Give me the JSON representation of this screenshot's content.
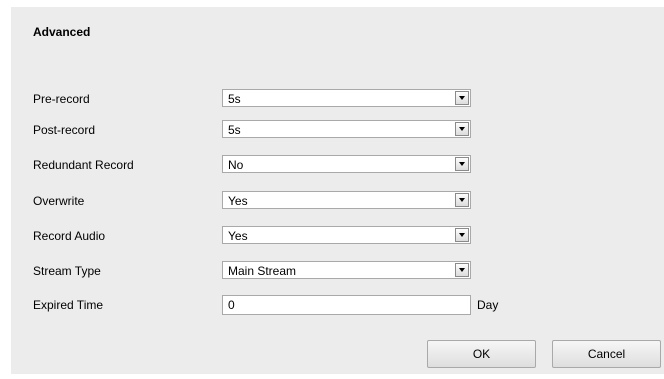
{
  "section": {
    "title": "Advanced"
  },
  "fields": {
    "pre_record": {
      "label": "Pre-record",
      "value": "5s"
    },
    "post_record": {
      "label": "Post-record",
      "value": "5s"
    },
    "redundant_record": {
      "label": "Redundant Record",
      "value": "No"
    },
    "overwrite": {
      "label": "Overwrite",
      "value": "Yes"
    },
    "record_audio": {
      "label": "Record Audio",
      "value": "Yes"
    },
    "stream_type": {
      "label": "Stream Type",
      "value": "Main Stream"
    },
    "expired_time": {
      "label": "Expired Time",
      "value": "0",
      "unit": "Day"
    }
  },
  "buttons": {
    "ok": "OK",
    "cancel": "Cancel"
  }
}
